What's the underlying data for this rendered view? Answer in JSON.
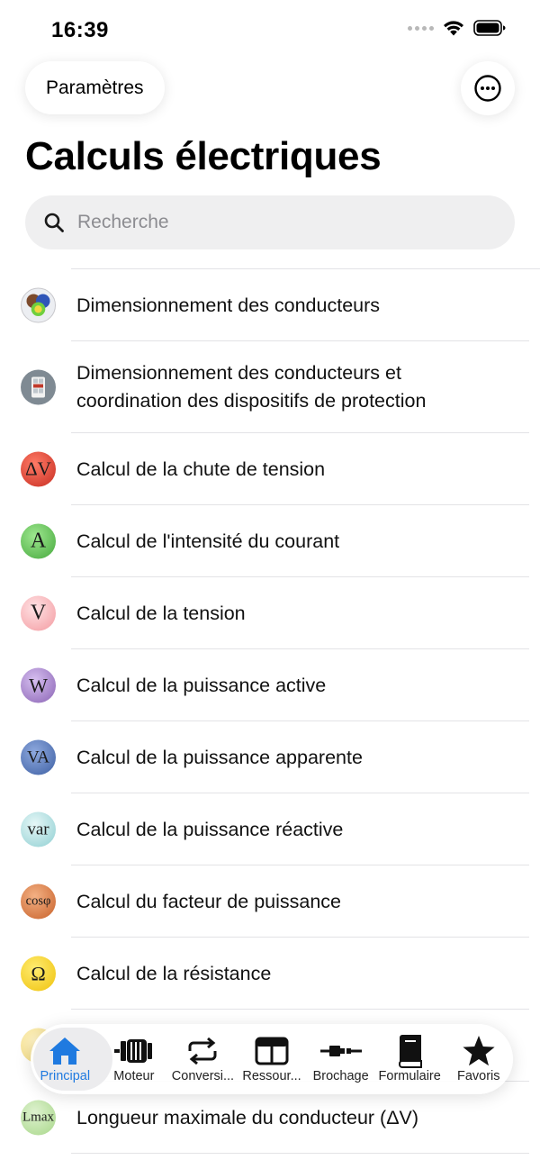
{
  "status": {
    "time": "16:39"
  },
  "nav": {
    "settings_label": "Paramètres"
  },
  "title": "Calculs électriques",
  "search": {
    "placeholder": "Recherche"
  },
  "items": [
    {
      "label": "Dimensionnement des conducteurs",
      "icon": "conductors-icon"
    },
    {
      "label": "Dimensionnement des conducteurs et coordination des dispositifs de protection",
      "icon": "protection-icon"
    },
    {
      "label": "Calcul de la chute de tension",
      "icon_text": "ΔV",
      "color": "#d0392f"
    },
    {
      "label": "Calcul de l'intensité du courant",
      "icon_text": "A",
      "color": "#5cbf55"
    },
    {
      "label": "Calcul de la tension",
      "icon_text": "V",
      "color": "#f7a3a8"
    },
    {
      "label": "Calcul de la puissance active",
      "icon_text": "W",
      "color": "#a27fc5"
    },
    {
      "label": "Calcul de la puissance apparente",
      "icon_text": "VA",
      "color": "#4d71b3"
    },
    {
      "label": "Calcul de la puissance réactive",
      "icon_text": "var",
      "color": "#9fd7d9"
    },
    {
      "label": "Calcul du facteur de puissance",
      "icon_text": "cosφ",
      "color": "#d9763d"
    },
    {
      "label": "Calcul de la résistance",
      "icon_text": "Ω",
      "color": "#f5d21b"
    },
    {
      "label": "",
      "icon_text": "",
      "color": "#f6e39a"
    },
    {
      "label": "Longueur maximale du conducteur (ΔV)",
      "icon_text": "Lmax",
      "color": "#b7df9c"
    }
  ],
  "tabs": [
    {
      "label": "Principal",
      "icon": "house-icon",
      "active": true
    },
    {
      "label": "Moteur",
      "icon": "motor-icon"
    },
    {
      "label": "Conversi...",
      "icon": "repeat-icon"
    },
    {
      "label": "Ressour...",
      "icon": "layout-icon"
    },
    {
      "label": "Brochage",
      "icon": "cable-icon"
    },
    {
      "label": "Formulaire",
      "icon": "book-icon"
    },
    {
      "label": "Favoris",
      "icon": "star-icon"
    }
  ],
  "colors": {
    "accent": "#1f7ae0"
  }
}
